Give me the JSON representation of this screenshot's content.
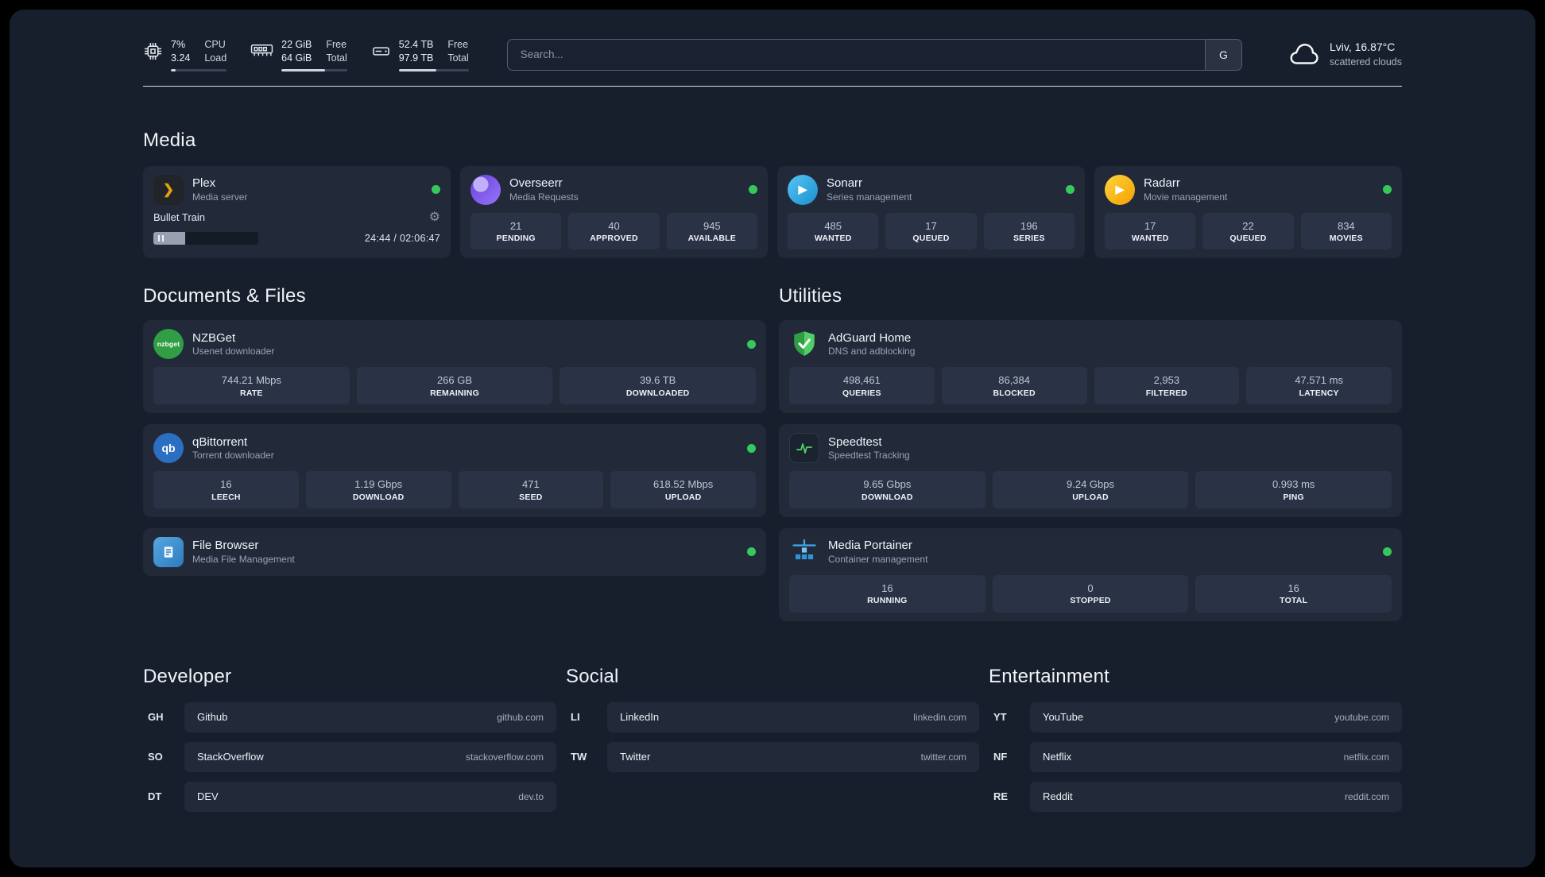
{
  "theme": {
    "bg": "#181f2c",
    "card": "#222a3a",
    "stat_box": "#2a3346",
    "status_green": "#35c95c",
    "text": "#f0f3f8",
    "muted": "#99a2b3"
  },
  "icons": {
    "gear": "⚙",
    "play": "▶",
    "plex_chevron": "❯",
    "qb": "qb",
    "nzbget": "nzbget"
  },
  "header": {
    "cpu": {
      "value_top": "7%",
      "value_bottom": "3.24",
      "label_top": "CPU",
      "label_bottom": "Load",
      "bar": 8
    },
    "ram": {
      "value_top": "22 GiB",
      "value_bottom": "64 GiB",
      "label_top": "Free",
      "label_bottom": "Total",
      "bar": 66
    },
    "disk": {
      "value_top": "52.4 TB",
      "value_bottom": "97.9 TB",
      "label_top": "Free",
      "label_bottom": "Total",
      "bar": 54
    },
    "search_placeholder": "Search...",
    "search_button": "G",
    "weather_location": "Lviv, 16.87°C",
    "weather_condition": "scattered clouds"
  },
  "media": {
    "title": "Media",
    "plex": {
      "name": "Plex",
      "subtitle": "Media server",
      "now_playing": "Bullet Train",
      "time": "24:44 / 02:06:47",
      "progress_percent": 30
    },
    "overseerr": {
      "name": "Overseerr",
      "subtitle": "Media Requests",
      "stats": [
        {
          "value": "21",
          "label": "PENDING"
        },
        {
          "value": "40",
          "label": "APPROVED"
        },
        {
          "value": "945",
          "label": "AVAILABLE"
        }
      ]
    },
    "sonarr": {
      "name": "Sonarr",
      "subtitle": "Series management",
      "stats": [
        {
          "value": "485",
          "label": "WANTED"
        },
        {
          "value": "17",
          "label": "QUEUED"
        },
        {
          "value": "196",
          "label": "SERIES"
        }
      ]
    },
    "radarr": {
      "name": "Radarr",
      "subtitle": "Movie management",
      "stats": [
        {
          "value": "17",
          "label": "WANTED"
        },
        {
          "value": "22",
          "label": "QUEUED"
        },
        {
          "value": "834",
          "label": "MOVIES"
        }
      ]
    }
  },
  "documents": {
    "title": "Documents & Files",
    "nzbget": {
      "name": "NZBGet",
      "subtitle": "Usenet downloader",
      "stats": [
        {
          "value": "744.21 Mbps",
          "label": "RATE"
        },
        {
          "value": "266 GB",
          "label": "REMAINING"
        },
        {
          "value": "39.6 TB",
          "label": "DOWNLOADED"
        }
      ]
    },
    "qbittorrent": {
      "name": "qBittorrent",
      "subtitle": "Torrent downloader",
      "stats": [
        {
          "value": "16",
          "label": "LEECH"
        },
        {
          "value": "1.19 Gbps",
          "label": "DOWNLOAD"
        },
        {
          "value": "471",
          "label": "SEED"
        },
        {
          "value": "618.52 Mbps",
          "label": "UPLOAD"
        }
      ]
    },
    "filebrowser": {
      "name": "File Browser",
      "subtitle": "Media File Management"
    }
  },
  "utilities": {
    "title": "Utilities",
    "adguard": {
      "name": "AdGuard Home",
      "subtitle": "DNS and adblocking",
      "stats": [
        {
          "value": "498,461",
          "label": "QUERIES"
        },
        {
          "value": "86,384",
          "label": "BLOCKED"
        },
        {
          "value": "2,953",
          "label": "FILTERED"
        },
        {
          "value": "47.571 ms",
          "label": "LATENCY"
        }
      ]
    },
    "speedtest": {
      "name": "Speedtest",
      "subtitle": "Speedtest Tracking",
      "stats": [
        {
          "value": "9.65 Gbps",
          "label": "DOWNLOAD"
        },
        {
          "value": "9.24 Gbps",
          "label": "UPLOAD"
        },
        {
          "value": "0.993 ms",
          "label": "PING"
        }
      ]
    },
    "portainer": {
      "name": "Media Portainer",
      "subtitle": "Container management",
      "stats": [
        {
          "value": "16",
          "label": "RUNNING"
        },
        {
          "value": "0",
          "label": "STOPPED"
        },
        {
          "value": "16",
          "label": "TOTAL"
        }
      ]
    }
  },
  "bookmarks": {
    "developer": {
      "title": "Developer",
      "items": [
        {
          "abbr": "GH",
          "name": "Github",
          "url": "github.com"
        },
        {
          "abbr": "SO",
          "name": "StackOverflow",
          "url": "stackoverflow.com"
        },
        {
          "abbr": "DT",
          "name": "DEV",
          "url": "dev.to"
        }
      ]
    },
    "social": {
      "title": "Social",
      "items": [
        {
          "abbr": "LI",
          "name": "LinkedIn",
          "url": "linkedin.com"
        },
        {
          "abbr": "TW",
          "name": "Twitter",
          "url": "twitter.com"
        }
      ]
    },
    "entertainment": {
      "title": "Entertainment",
      "items": [
        {
          "abbr": "YT",
          "name": "YouTube",
          "url": "youtube.com"
        },
        {
          "abbr": "NF",
          "name": "Netflix",
          "url": "netflix.com"
        },
        {
          "abbr": "RE",
          "name": "Reddit",
          "url": "reddit.com"
        }
      ]
    }
  }
}
